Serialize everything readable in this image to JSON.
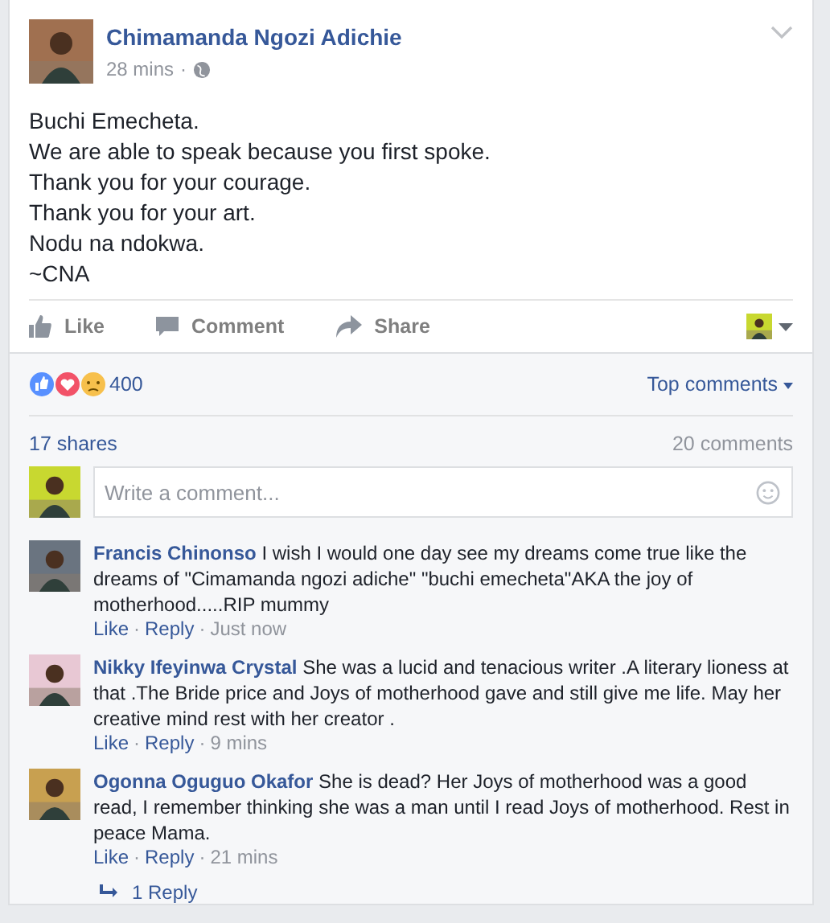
{
  "post": {
    "author": "Chimamanda Ngozi Adichie",
    "time": "28 mins",
    "separator": "·",
    "lines": [
      "Buchi Emecheta.",
      "We are able to speak because you first spoke.",
      "Thank you for your courage.",
      "Thank you for your art.",
      "Nodu na ndokwa.",
      "~CNA"
    ]
  },
  "actions": [
    "Like",
    "Comment",
    "Share"
  ],
  "reactions": {
    "count": "400",
    "sort": "Top comments"
  },
  "stats": {
    "shares": "17 shares",
    "comments": "20 comments"
  },
  "composer": {
    "placeholder": "Write a comment..."
  },
  "comments": [
    {
      "author": "Francis Chinonso",
      "text": "I wish I would one day see my dreams come true like the dreams of \"Cimamanda ngozi adiche\" \"buchi emecheta\"AKA the joy of motherhood.....RIP mummy",
      "like": "Like",
      "sep": "·",
      "reply": "Reply",
      "time": "Just now"
    },
    {
      "author": "Nikky Ifeyinwa Crystal",
      "text": "She was a lucid and tenacious writer .A literary lioness at that .The Bride price and Joys of motherhood gave and still give me life. May her creative mind rest with her creator .",
      "like": "Like",
      "sep": "·",
      "reply": "Reply",
      "time": "9 mins"
    },
    {
      "author": "Ogonna Oguguo Okafor",
      "text": "She is dead? Her Joys of motherhood was a good read, I remember thinking she was a man until I read Joys of motherhood. Rest in peace Mama.",
      "like": "Like",
      "sep": "·",
      "reply": "Reply",
      "time": "21 mins"
    }
  ],
  "replies": {
    "label": "1 Reply"
  }
}
